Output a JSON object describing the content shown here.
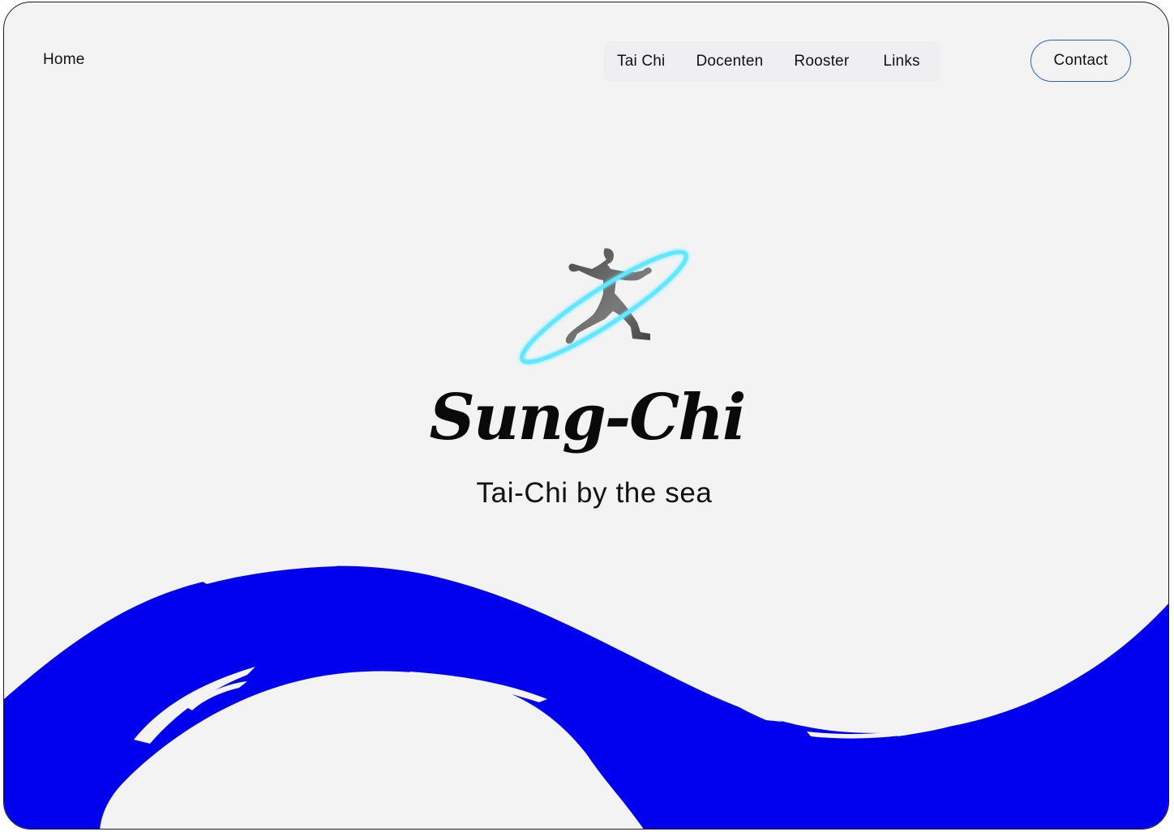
{
  "nav": {
    "home": "Home",
    "items": [
      "Tai Chi",
      "Docenten",
      "Rooster",
      "Links"
    ],
    "contact": "Contact"
  },
  "hero": {
    "title": "Sung-Chi",
    "subtitle": "Tai-Chi by the sea"
  },
  "colors": {
    "background": "#f3f3f4",
    "wave": "#0000ee",
    "ring": "#5fe8ff",
    "figure": "#6b6b6b",
    "contact_border": "#2a62c9"
  },
  "icons": {
    "logo": "tai-chi-figure-with-ring"
  }
}
